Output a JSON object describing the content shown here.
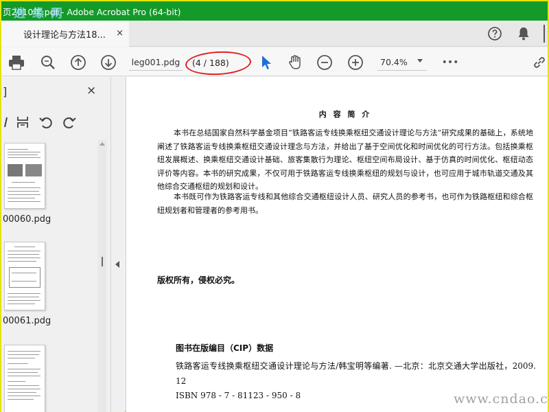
{
  "window": {
    "title": "页2010年.pdf - Adobe Acrobat Pro (64-bit)",
    "watermark": "逍 缘 网"
  },
  "tab": {
    "label": "设计理论与方法18...",
    "close": "×"
  },
  "toolbar": {
    "page_field": "leg001.pdg",
    "page_count": "(4 / 188)",
    "zoom": "70.4%",
    "more": "•••"
  },
  "left_panel": {
    "bracket": "]",
    "close": "×",
    "thumbnails": [
      {
        "label": "00060.pdg"
      },
      {
        "label": "00061.pdg"
      },
      {
        "label": ""
      }
    ]
  },
  "document": {
    "heading": "内 容 简 介",
    "paragraphs": [
      "本书在总结国家自然科学基金项目“铁路客运专线换乘枢纽交通设计理论与方法”研究成果的基础上，系统地阐述了铁路客运专线换乘枢纽交通设计理念与方法，并给出了基于空间优化和时间优化的可行方法。包括换乘枢纽发展概述、换乘枢纽交通设计基础、旅客集散行为理论、枢纽空间布局设计、基于仿真的时间优化、枢纽动态评价等内容。本书的研究成果，不仅可用于铁路客运专线换乘枢纽的规划与设计，也可应用于城市轨道交通及其他综合交通枢纽的规划和设计。",
      "本书既可作为铁路客运专线和其他综合交通枢纽设计人员、研究人员的参考书，也可作为铁路枢纽和综合枢纽规划者和管理者的参考用书。"
    ],
    "copyright": "版权所有，侵权必究。",
    "cip_title": "图书在版编目（CIP）数据",
    "cip_lines": [
      "铁路客运专线换乘枢纽交通设计理论与方法/韩宝明等编著. —北京：北京交通大学出版社，2009. 12",
      "ISBN 978 - 7 - 81123 - 950 - 8"
    ],
    "watermark": "www.cndao.com"
  }
}
